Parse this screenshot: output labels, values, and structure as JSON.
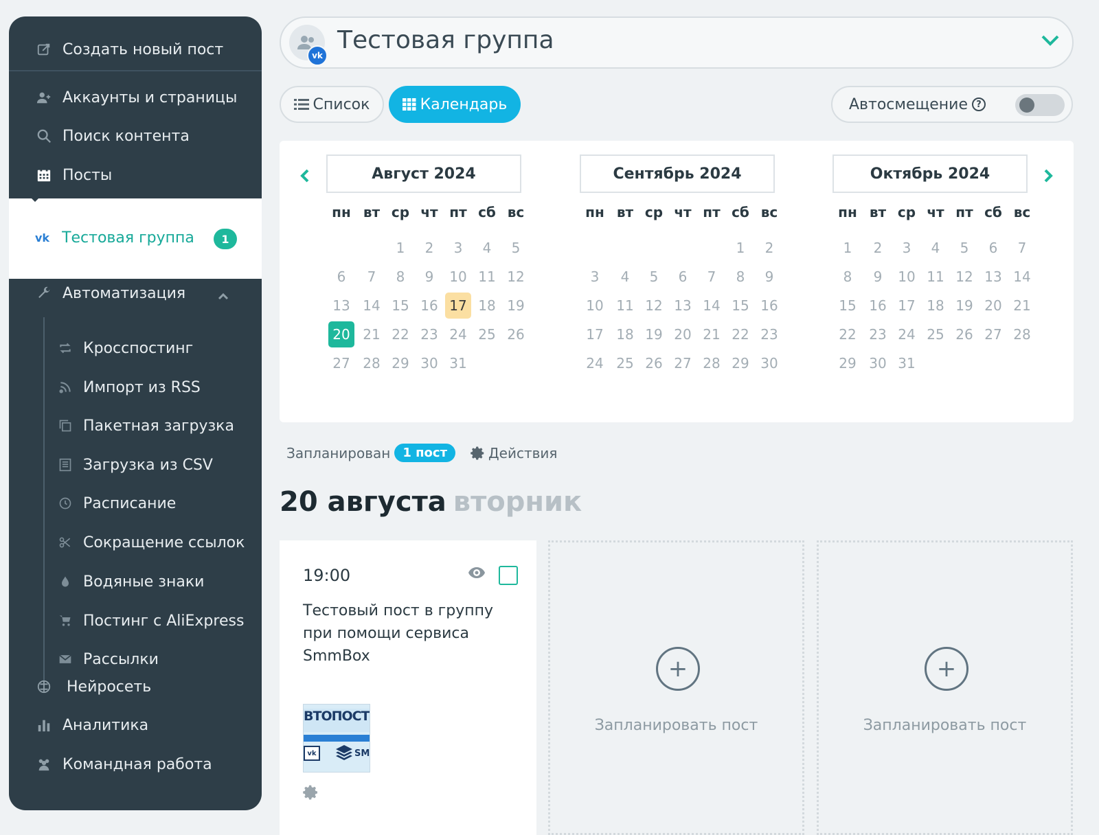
{
  "sidebar": {
    "create_post": "Создать новый пост",
    "accounts": "Аккаунты и страницы",
    "search": "Поиск контента",
    "posts": "Посты",
    "active_group": {
      "network": "vk",
      "label": "Тестовая группа",
      "badge": "1"
    },
    "automation": "Автоматизация",
    "automation_items": [
      {
        "label": "Кросспостинг",
        "icon": "repost-icon"
      },
      {
        "label": "Импорт из RSS",
        "icon": "rss-icon"
      },
      {
        "label": "Пакетная загрузка",
        "icon": "copy-icon"
      },
      {
        "label": "Загрузка из CSV",
        "icon": "csv-icon"
      },
      {
        "label": "Расписание",
        "icon": "clock-icon"
      },
      {
        "label": "Сокращение ссылок",
        "icon": "scissors-icon"
      },
      {
        "label": "Водяные знаки",
        "icon": "drop-icon"
      },
      {
        "label": "Постинг с AliExpress",
        "icon": "cart-icon"
      },
      {
        "label": "Рассылки",
        "icon": "mail-icon"
      }
    ],
    "neural": "Нейросеть",
    "analytics": "Аналитика",
    "team": "Командная работа"
  },
  "header": {
    "group_title": "Тестовая группа",
    "network_badge": "vk",
    "view_list": "Список",
    "view_calendar": "Календарь",
    "autoshift": "Автосмещение",
    "autoshift_on": false
  },
  "weekdays": [
    "пн",
    "вт",
    "ср",
    "чт",
    "пт",
    "сб",
    "вс"
  ],
  "calendar": {
    "months": [
      {
        "title": "Август 2024",
        "first_dow": 3,
        "days": 31,
        "today": 17,
        "selected": 20
      },
      {
        "title": "Сентябрь 2024",
        "first_dow": 6,
        "days": 30,
        "today": null,
        "selected": null
      },
      {
        "title": "Октябрь 2024",
        "first_dow": 1,
        "days": 31,
        "today": null,
        "selected": null
      }
    ]
  },
  "schedule": {
    "label": "Запланирован",
    "count_badge": "1 пост",
    "actions": "Действия",
    "date": "20 августа",
    "weekday": "вторник",
    "post": {
      "time": "19:00",
      "text": "Тестовый пост в группу при помощи сервиса SmmBox",
      "thumb_text": "ВТОПОСТИНГ",
      "thumb_brand": "SM",
      "thumb_vk": "vk"
    },
    "empty_slot_label": "Запланировать пост"
  },
  "colors": {
    "accent_teal": "#1eb89c",
    "accent_blue": "#12b4e3",
    "sidebar_bg": "#2e3e48",
    "today_bg": "#fbdfa2"
  }
}
